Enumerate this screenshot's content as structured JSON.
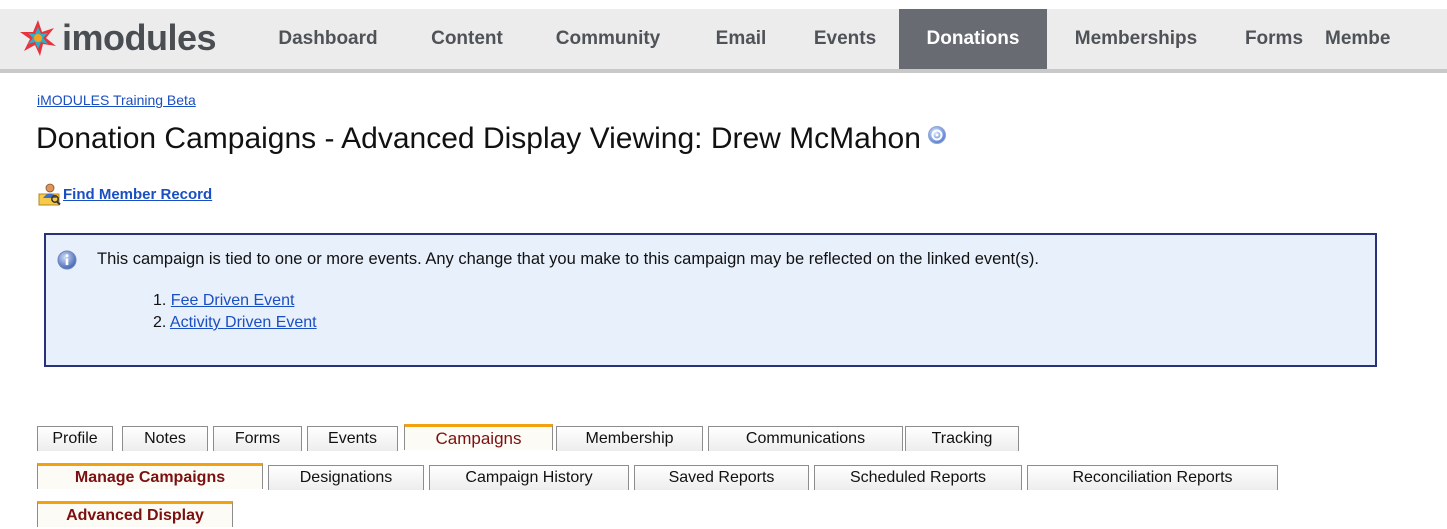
{
  "app": {
    "logo_text": "imodules",
    "nav": [
      "Dashboard",
      "Content",
      "Community",
      "Email",
      "Events",
      "Donations",
      "Memberships",
      "Forms",
      "Membe"
    ],
    "active_nav": "Donations"
  },
  "breadcrumb": "iMODULES Training Beta",
  "page": {
    "title": "Donation Campaigns - Advanced Display Viewing: Drew McMahon",
    "find_member_label": "Find Member Record"
  },
  "notice": {
    "message": "This campaign is tied to one or more events. Any change that you make to this campaign may be reflected on the linked event(s).",
    "events": [
      {
        "num": "1.",
        "label": "Fee Driven Event"
      },
      {
        "num": "2.",
        "label": "Activity Driven Event"
      }
    ]
  },
  "tabs": {
    "row1": [
      "Profile",
      "Notes",
      "Forms",
      "Events",
      "Campaigns",
      "Membership",
      "Communications",
      "Tracking"
    ],
    "row1_active": "Campaigns",
    "row2": [
      "Manage Campaigns",
      "Designations",
      "Campaign History",
      "Saved Reports",
      "Scheduled Reports",
      "Reconciliation Reports"
    ],
    "row2_active": "Manage Campaigns",
    "row3": [
      "Advanced Display"
    ],
    "row3_active": "Advanced Display"
  },
  "colors": {
    "nav_active_bg": "#686c72",
    "link": "#1a4fc2",
    "tab_active_accent": "#f3a20f",
    "tab_active_text": "#7c1010",
    "notice_bg": "#e8f0fc",
    "notice_border": "#27327a"
  },
  "icons": [
    "imodules-logo-icon",
    "help-icon",
    "find-member-icon",
    "info-icon"
  ]
}
